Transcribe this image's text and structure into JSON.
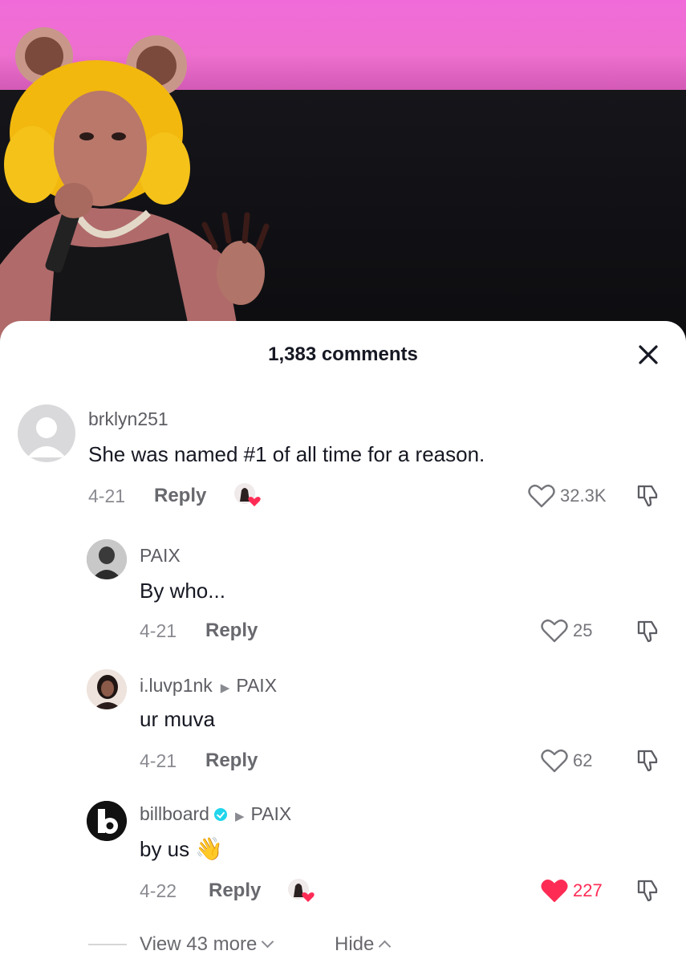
{
  "header": {
    "title": "1,383 comments"
  },
  "icons": {
    "close": "close-icon",
    "like": "heart-icon",
    "dislike": "thumbs-down-icon",
    "creator_liked": "creator-liked-icon",
    "verified": "verified-badge-icon"
  },
  "colors": {
    "accent": "#fe2c55",
    "verified": "#20d5ec",
    "text": "#161823",
    "muted": "#8a8b91"
  },
  "comments": [
    {
      "username": "brklyn251",
      "text": "She was named #1 of all time for a reason.",
      "date": "4-21",
      "reply_label": "Reply",
      "likes": "32.3K",
      "liked_by_creator": true,
      "liked": false
    },
    {
      "username": "PAIX",
      "text": "By who...",
      "date": "4-21",
      "reply_label": "Reply",
      "likes": "25",
      "liked": false
    },
    {
      "username": "i.luvp1nk",
      "reply_to": "PAIX",
      "text": "ur muva",
      "date": "4-21",
      "reply_label": "Reply",
      "likes": "62",
      "liked": false
    },
    {
      "username": "billboard",
      "verified": true,
      "reply_to": "PAIX",
      "text": "by us",
      "emoji": "👋",
      "date": "4-22",
      "reply_label": "Reply",
      "likes": "227",
      "liked": true,
      "liked_by_creator": true
    }
  ],
  "footer": {
    "view_more": "View 43 more",
    "hide": "Hide"
  }
}
